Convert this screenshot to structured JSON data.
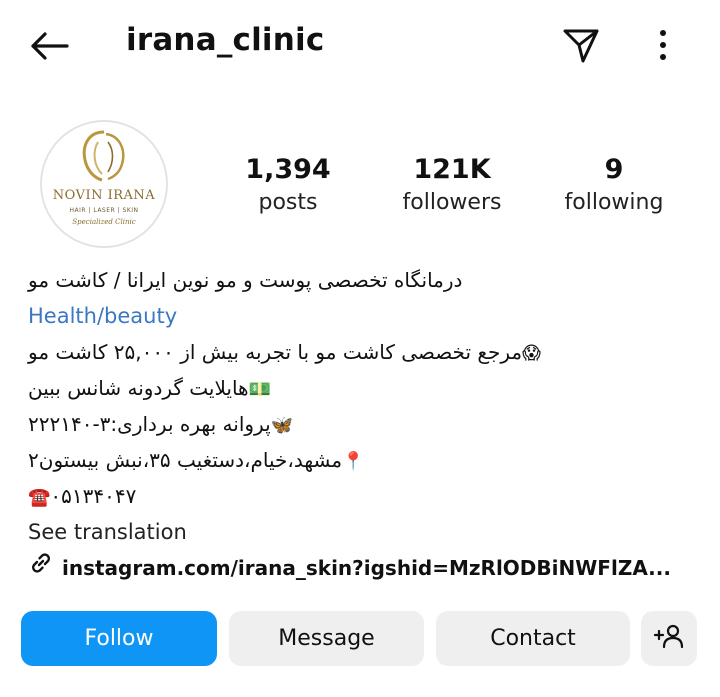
{
  "header": {
    "username": "irana_clinic",
    "back_icon": "arrow-left-icon",
    "send_icon": "paper-plane-icon",
    "more_icon": "more-vertical-icon"
  },
  "avatar": {
    "brand": "NOVIN IRANA",
    "subtitle": "HAIR | LASER | SKIN",
    "script": "Specialized Clinic"
  },
  "stats": {
    "posts": {
      "value": "1,394",
      "label": "posts"
    },
    "followers": {
      "value": "121K",
      "label": "followers"
    },
    "following": {
      "value": "9",
      "label": "following"
    }
  },
  "bio": {
    "name": "درمانگاه تخصصی پوست و مو نوین ایرانا / کاشت مو",
    "category": "Health/beauty",
    "lines": [
      {
        "emoji": "😱",
        "text": "مرجع تخصصی کاشت مو با تجربه بیش از ۲۵,۰۰۰ کاشت مو"
      },
      {
        "emoji": "💵",
        "text": "هایلایت گردونه شانس ببین"
      },
      {
        "emoji": "🦋",
        "text": "پروانه بهره برداری:۳-۲۲۲۱۴۰"
      },
      {
        "emoji": "📍",
        "text": "مشهد،خیام،دستغیب ۳۵،نبش بیستون۲"
      },
      {
        "emoji": "☎️",
        "text": "۰۵۱۳۴۰۴۷"
      }
    ],
    "see_translation": "See translation",
    "link_icon": "link-icon",
    "link_text": "instagram.com/irana_skin?igshid=MzRlODBiNWFlZA..."
  },
  "actions": {
    "follow": "Follow",
    "message": "Message",
    "contact": "Contact",
    "add_user_icon": "add-user-icon"
  },
  "colors": {
    "follow_bg": "#0f95f6",
    "secondary_bg": "#efefef",
    "category_text": "#3b78c2"
  }
}
